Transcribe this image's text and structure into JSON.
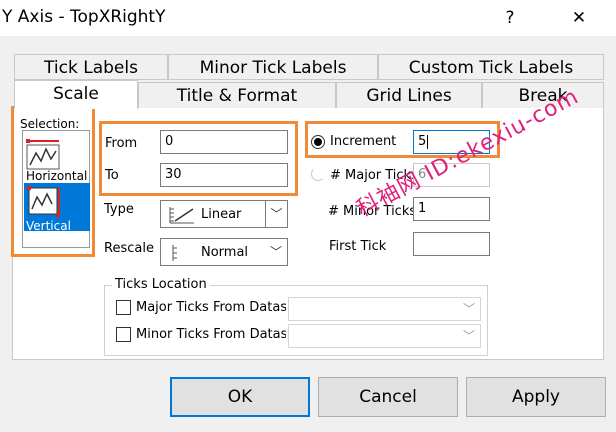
{
  "window": {
    "title": "Y Axis - TopXRightY",
    "help_glyph": "?",
    "close_glyph": "✕"
  },
  "tabs": {
    "row1": [
      "Tick Labels",
      "Minor Tick Labels",
      "Custom Tick Labels"
    ],
    "row2": [
      "Scale",
      "Title & Format",
      "Grid Lines",
      "Break"
    ],
    "active": "Scale"
  },
  "selection": {
    "label": "Selection:",
    "items": [
      {
        "label": "Horizontal",
        "icon": "horizontal-axis-icon"
      },
      {
        "label": "Vertical",
        "icon": "vertical-axis-icon",
        "selected": true
      }
    ]
  },
  "scale": {
    "from_label": "From",
    "from_value": "0",
    "to_label": "To",
    "to_value": "30",
    "type_label": "Type",
    "type_value": "Linear",
    "rescale_label": "Rescale",
    "rescale_value": "Normal"
  },
  "ticks": {
    "increment_label": "Increment",
    "increment_value": "5",
    "major_label": "# Major Ticks",
    "major_value": "6",
    "minor_label": "# Minor Ticks",
    "minor_value": "1",
    "first_label": "First Tick",
    "first_value": ""
  },
  "ticks_location": {
    "label": "Ticks Location",
    "major_label": "Major Ticks From Dataset",
    "minor_label": "Minor Ticks From Dataset"
  },
  "buttons": {
    "ok": "OK",
    "cancel": "Cancel",
    "apply": "Apply"
  },
  "watermark": "科袖网 ID:ekexiu-com",
  "colors": {
    "highlight_box": "#f08a35",
    "selection": "#0078d7",
    "watermark": "#e0207a"
  }
}
